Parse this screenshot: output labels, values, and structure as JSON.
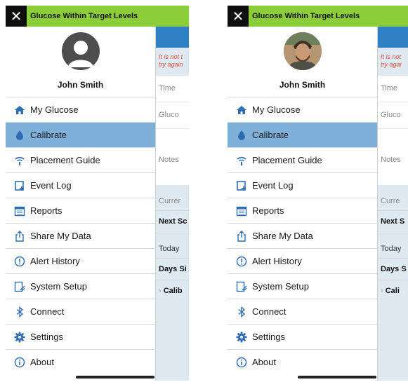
{
  "status_text": "Glucose Within Target Levels",
  "user_name": "John Smith",
  "menu": [
    {
      "label": "My Glucose",
      "icon": "home-icon"
    },
    {
      "label": "Calibrate",
      "icon": "drop-icon"
    },
    {
      "label": "Placement Guide",
      "icon": "signal-icon"
    },
    {
      "label": "Event Log",
      "icon": "event-add-icon"
    },
    {
      "label": "Reports",
      "icon": "calendar-icon"
    },
    {
      "label": "Share My Data",
      "icon": "share-icon"
    },
    {
      "label": "Alert History",
      "icon": "alert-icon"
    },
    {
      "label": "System Setup",
      "icon": "setup-icon"
    },
    {
      "label": "Connect",
      "icon": "bluetooth-icon"
    },
    {
      "label": "Settings",
      "icon": "gear-icon"
    },
    {
      "label": "About",
      "icon": "info-icon"
    }
  ],
  "left_bg": {
    "error1": "It is not t",
    "error2": "try again",
    "time": "Time",
    "glucose": "Gluco",
    "notes": "Notes",
    "current": "Currer",
    "next": "Next Sc",
    "today": "Today",
    "days": "Days Si",
    "calib": "Calib"
  },
  "right_bg": {
    "error1": "It is not",
    "error2": "try agai",
    "time": "Time",
    "glucose": "Gluco",
    "notes": "Notes",
    "current": "Curre",
    "next": "Next S",
    "today": "Today",
    "days": "Days S",
    "calib": "Cali"
  },
  "colors": {
    "status_green": "#8ccd3a",
    "active_blue": "#7fb0da",
    "icon_blue": "#2e6db4"
  }
}
